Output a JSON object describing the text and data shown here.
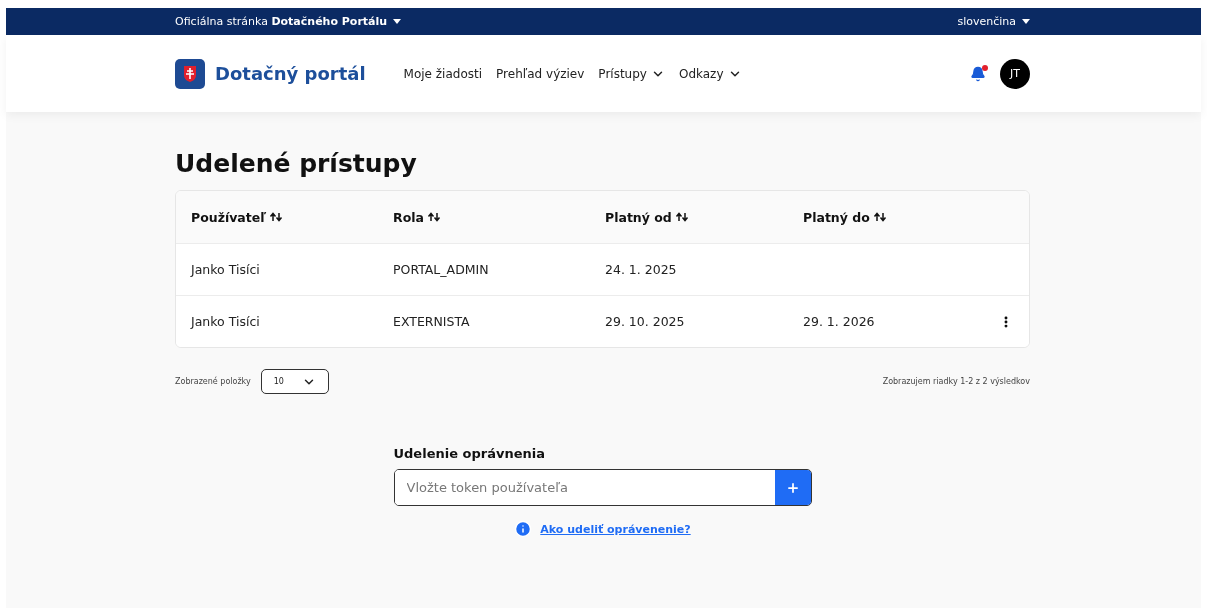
{
  "top_bar": {
    "official_prefix": "Oficiálna stránka",
    "official_bold": "Dotačného Portálu",
    "language": "slovenčina"
  },
  "header": {
    "logo": "Dotačný portál",
    "nav": [
      {
        "label": "Moje žiadosti",
        "dropdown": false
      },
      {
        "label": "Prehľad výziev",
        "dropdown": false
      },
      {
        "label": "Prístupy",
        "dropdown": true
      },
      {
        "label": "Odkazy",
        "dropdown": true
      }
    ],
    "notification_unread": true,
    "avatar": "JT"
  },
  "page_title": "Udelené prístupy",
  "table": {
    "columns": [
      "Používateľ",
      "Rola",
      "Platný od",
      "Platný do"
    ],
    "rows": [
      {
        "user": "Janko Tisíci",
        "role": "PORTAL_ADMIN",
        "valid_from": "24. 1. 2025",
        "menu": false
      },
      {
        "user": "Janko Tisíci",
        "role": "EXTERNISTA",
        "valid_from": "29. 10. 2025",
        "valid_to": "29. 1. 2026",
        "menu": true
      }
    ]
  },
  "pagination": {
    "label": "Zobrazené položky",
    "page_size": "10",
    "summary": "Zobrazujem riadky 1-2 z 2 výsledkov"
  },
  "grant": {
    "title": "Udelenie oprávnenia",
    "placeholder": "Vložte token používateľa",
    "help_link": "Ako udeliť oprávenenie?"
  }
}
